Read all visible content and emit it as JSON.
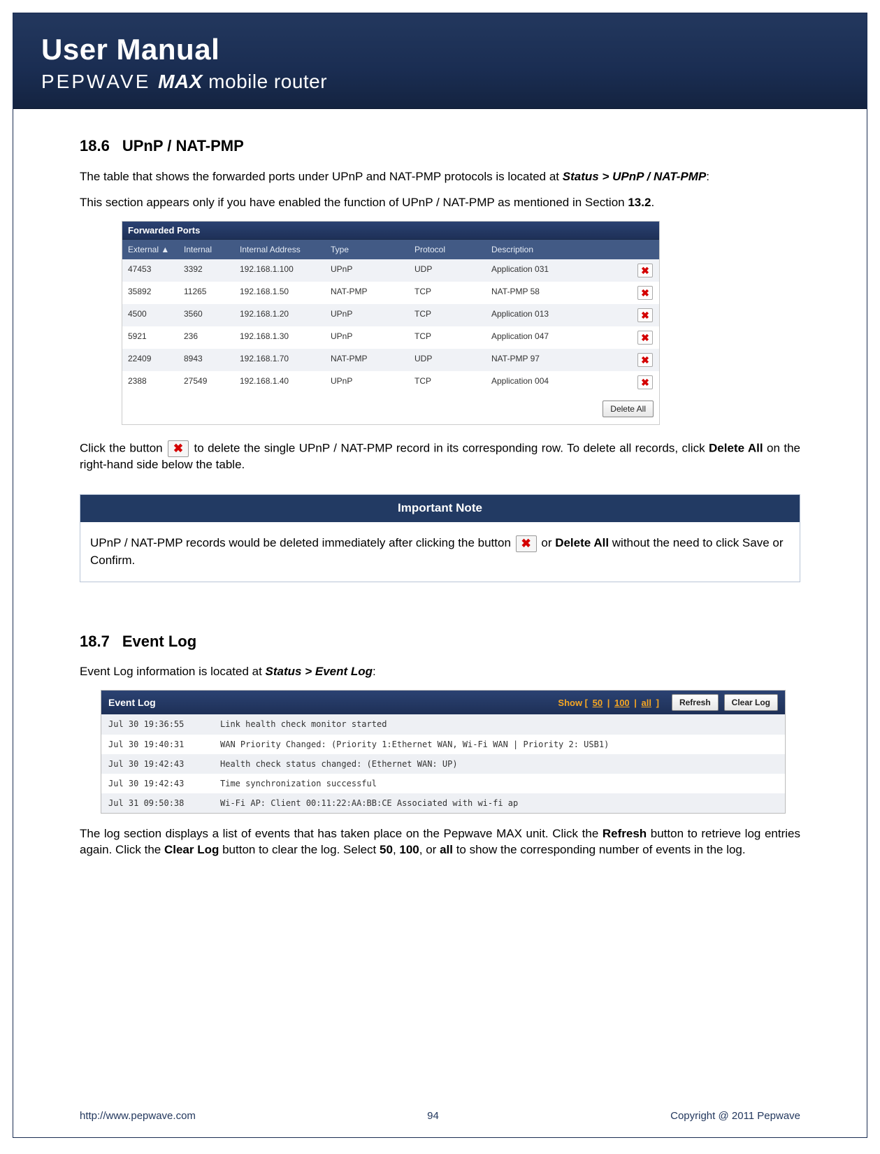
{
  "header": {
    "title": "User Manual",
    "sub_pep": "PEPWAVE ",
    "sub_max": "MAX",
    "sub_mr": " mobile router"
  },
  "section186": {
    "num": "18.6",
    "title": "UPnP / NAT-PMP",
    "p1a": "The table that shows the forwarded ports under UPnP and NAT-PMP protocols is located at ",
    "p1b": "Status > UPnP / NAT-PMP",
    "p1c": ":",
    "p2a": "This section appears only if you have enabled the function of UPnP / NAT-PMP as mentioned in Section ",
    "p2b": "13.2",
    "p2c": ".",
    "p3a": "Click the button ",
    "p3b": " to delete the single UPnP / NAT-PMP record in its corresponding row. To delete all records, click ",
    "p3c": "Delete All",
    "p3d": " on the right-hand side below the table."
  },
  "fw": {
    "title": "Forwarded Ports",
    "headers": {
      "ext": "External ▲",
      "int": "Internal",
      "addr": "Internal Address",
      "type": "Type",
      "proto": "Protocol",
      "desc": "Description"
    },
    "rows": [
      {
        "ext": "47453",
        "int": "3392",
        "addr": "192.168.1.100",
        "type": "UPnP",
        "proto": "UDP",
        "desc": "Application 031"
      },
      {
        "ext": "35892",
        "int": "11265",
        "addr": "192.168.1.50",
        "type": "NAT-PMP",
        "proto": "TCP",
        "desc": "NAT-PMP 58"
      },
      {
        "ext": "4500",
        "int": "3560",
        "addr": "192.168.1.20",
        "type": "UPnP",
        "proto": "TCP",
        "desc": "Application 013"
      },
      {
        "ext": "5921",
        "int": "236",
        "addr": "192.168.1.30",
        "type": "UPnP",
        "proto": "TCP",
        "desc": "Application 047"
      },
      {
        "ext": "22409",
        "int": "8943",
        "addr": "192.168.1.70",
        "type": "NAT-PMP",
        "proto": "UDP",
        "desc": "NAT-PMP 97"
      },
      {
        "ext": "2388",
        "int": "27549",
        "addr": "192.168.1.40",
        "type": "UPnP",
        "proto": "TCP",
        "desc": "Application 004"
      }
    ],
    "delete_all": "Delete All"
  },
  "note": {
    "title": "Important Note",
    "a": "UPnP / NAT-PMP records would be deleted immediately after clicking the button ",
    "b": " or ",
    "c": "Delete All",
    "d": " without the need to click Save or Confirm."
  },
  "section187": {
    "num": "18.7",
    "title": "Event Log",
    "p1a": "Event Log information is located at ",
    "p1b": "Status > Event Log",
    "p1c": ":",
    "p2a": "The log section displays a list of events that has taken place on the Pepwave MAX unit.  Click the ",
    "p2b": "Refresh",
    "p2c": " button to retrieve log entries again.  Click the ",
    "p2d": "Clear Log",
    "p2e": " button to clear the log.  Select ",
    "p2f": "50",
    "p2g": ", ",
    "p2h": "100",
    "p2i": ", or ",
    "p2j": "all",
    "p2k": " to show the corresponding number of events in the log."
  },
  "ev": {
    "title": "Event Log",
    "show_label": "Show [ ",
    "show_50": "50",
    "show_sep1": " | ",
    "show_100": "100",
    "show_sep2": " | ",
    "show_all": "all",
    "show_end": " ]",
    "refresh": "Refresh",
    "clear": "Clear Log",
    "rows": [
      {
        "t": "Jul 30 19:36:55",
        "m": "Link health check monitor started"
      },
      {
        "t": "Jul 30 19:40:31",
        "m": "WAN Priority Changed: (Priority 1:Ethernet WAN, Wi-Fi WAN | Priority 2: USB1)"
      },
      {
        "t": "Jul 30 19:42:43",
        "m": "Health check status changed: (Ethernet WAN: UP)"
      },
      {
        "t": "Jul 30 19:42:43",
        "m": "Time synchronization successful"
      },
      {
        "t": "Jul 31 09:50:38",
        "m": "Wi-Fi AP: Client 00:11:22:AA:BB:CE Associated with wi-fi ap"
      }
    ]
  },
  "footer": {
    "url": "http://www.pepwave.com",
    "page": "94",
    "copy": "Copyright @ 2011 Pepwave"
  }
}
